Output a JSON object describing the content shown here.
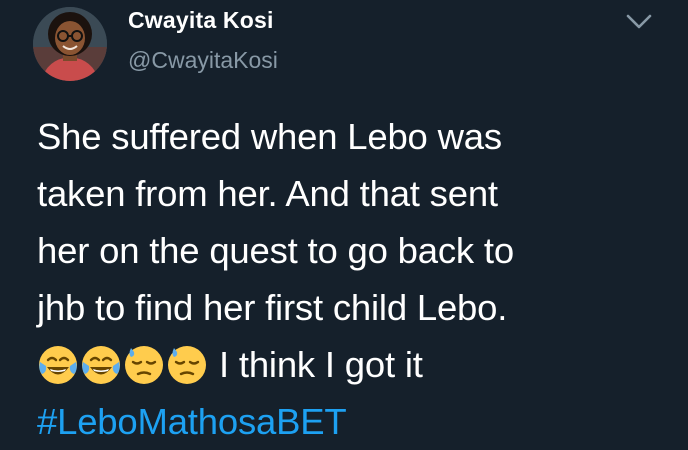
{
  "tweet": {
    "display_name": "Cwayita Kosi",
    "handle": "@CwayitaKosi",
    "lines": [
      "She suffered when Lebo was",
      "taken from her. And that sent",
      "her on the quest to go back to",
      "jhb to find her first child Lebo."
    ],
    "emojis": [
      "tears-of-joy-emoji",
      "tears-of-joy-emoji",
      "downcast-sweat-emoji",
      "downcast-sweat-emoji"
    ],
    "after_emoji_text": "I think I got it",
    "hashtag": "#LeboMathosaBET",
    "caret_icon": "chevron-down-icon"
  },
  "colors": {
    "background": "#15202b",
    "text": "#ffffff",
    "secondary": "#8899a6",
    "link": "#1da1f2"
  }
}
